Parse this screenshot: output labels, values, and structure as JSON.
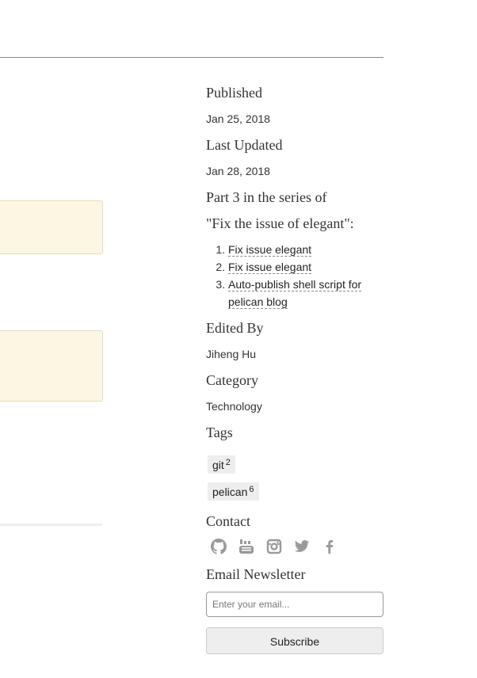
{
  "sidebar": {
    "published_heading": "Published",
    "published_date": "Jan 25, 2018",
    "updated_heading": "Last Updated",
    "updated_date": "Jan 28, 2018",
    "series_heading_line1": "Part 3 in the series of",
    "series_heading_line2": "\"Fix the issue of elegant\":",
    "series_items": [
      {
        "label": "Fix issue elegant"
      },
      {
        "label": "Fix issue elegant"
      },
      {
        "label": "Auto-publish shell script for pelican blog"
      }
    ],
    "edited_heading": "Edited By",
    "editor": "Jiheng Hu",
    "category_heading": "Category",
    "category": "Technology",
    "tags_heading": "Tags",
    "tags": [
      {
        "name": "git",
        "count": "2"
      },
      {
        "name": "pelican",
        "count": "6"
      }
    ],
    "contact_heading": "Contact",
    "contact_icons": [
      "github-icon",
      "youtube-icon",
      "instagram-icon",
      "twitter-icon",
      "facebook-icon"
    ],
    "newsletter_heading": "Email Newsletter",
    "email_placeholder": "Enter your email...",
    "subscribe_label": "Subscribe"
  },
  "colors": {
    "icon": "#9a9a9a",
    "box_bg": "#fdf6e3",
    "tag_bg": "#eeeeee"
  }
}
